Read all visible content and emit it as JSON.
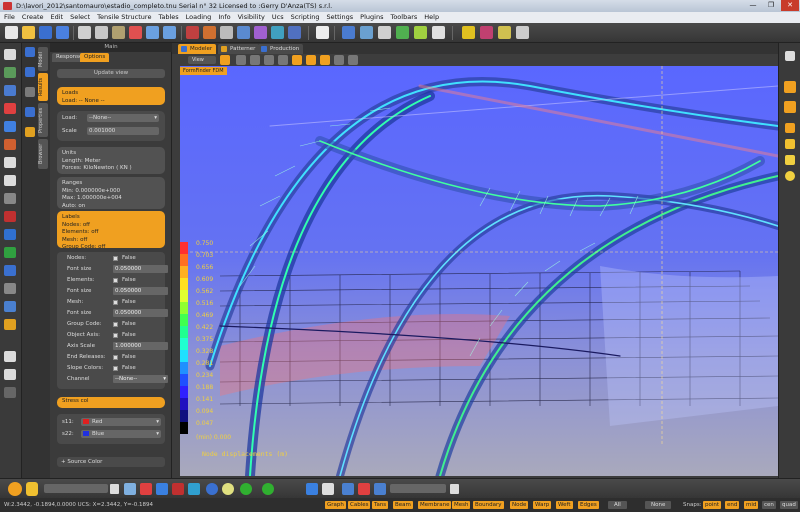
{
  "window": {
    "title": "D:\\lavori_2012\\santomauro\\estadio_completo.tnu  Serial n° 32  Licensed to :Gerry D'Anza(TS) s.r.l.",
    "controls": [
      "—",
      "❐",
      "✕"
    ]
  },
  "menu": [
    "File",
    "Create",
    "Edit",
    "Select",
    "Tensile Structure",
    "Tables",
    "Loading",
    "Info",
    "Visibility",
    "Ucs",
    "Scripting",
    "Settings",
    "Plugins",
    "Toolbars",
    "Help"
  ],
  "panel": {
    "header": "Main",
    "tabs": {
      "response": "Response",
      "options": "Options"
    },
    "update_view": "Update view",
    "vertical_tabs": [
      "Model",
      "Results",
      "Properties",
      "Browser"
    ],
    "loads_box": {
      "title": "Loads",
      "value": "Load: -- None --"
    },
    "load_field": {
      "label": "Load:",
      "value": "--None--"
    },
    "scale_field": {
      "label": "Scale",
      "value": "0.001000"
    },
    "units": {
      "title": "Units",
      "length": "Length: Meter",
      "forces": "Forces: KiloNewton ( KN )"
    },
    "ranges": {
      "title": "Ranges",
      "min": "Min: 0.000000e+000",
      "max": "Max: 1.000000e+004",
      "auto": "Auto: on"
    },
    "labels_box": {
      "title": "Labels",
      "nodes": "Nodes: off",
      "elements": "Elements: off",
      "mesh": "Mesh: off",
      "group_code": "Group Code: off"
    },
    "options": [
      {
        "label": "Nodes:",
        "type": "check",
        "value": "False"
      },
      {
        "label": "Font size",
        "type": "field",
        "value": "0.050000"
      },
      {
        "label": "Elements:",
        "type": "check",
        "value": "False"
      },
      {
        "label": "Font size",
        "type": "field",
        "value": "0.050000"
      },
      {
        "label": "Mesh:",
        "type": "check",
        "value": "False"
      },
      {
        "label": "Font size",
        "type": "field",
        "value": "0.050000"
      },
      {
        "label": "Group Code:",
        "type": "check",
        "value": "False"
      },
      {
        "label": "Object Axis:",
        "type": "check",
        "value": "False"
      },
      {
        "label": "Axis Scale",
        "type": "field",
        "value": "1.000000"
      },
      {
        "label": "End Releases:",
        "type": "check",
        "value": "False"
      },
      {
        "label": "Slope Colors:",
        "type": "check",
        "value": "False"
      },
      {
        "label": "Channel",
        "type": "select",
        "value": "--None--"
      }
    ],
    "stress_box": {
      "title": "Stress col",
      "s11_label": "s11:",
      "s11_value": "Red",
      "s22_label": "s22:",
      "s22_value": "Blue",
      "s11_color": "#e02020",
      "s22_color": "#2030e0"
    },
    "source_color": "+ Source Color"
  },
  "view_tabs": [
    "Modeler",
    "Patterner",
    "Production"
  ],
  "view_toolbar": {
    "view_label": "View"
  },
  "formfinder_badge": "FormFinder  FDM",
  "legend": {
    "values": [
      "0.750",
      "0.703",
      "0.656",
      "0.609",
      "0.562",
      "0.516",
      "0.469",
      "0.422",
      "0.375",
      "0.328",
      "0.281",
      "0.234",
      "0.188",
      "0.141",
      "0.094",
      "0.047"
    ],
    "min_label": "(min)  0.000",
    "caption": "Node displacements (m)",
    "colors": [
      "#ff3030",
      "#ff7020",
      "#ffb020",
      "#ffe020",
      "#e0ff30",
      "#90ff30",
      "#40ff50",
      "#20ff90",
      "#20ffd0",
      "#20e0ff",
      "#2090ff",
      "#2050ff",
      "#3020ff",
      "#2010c0",
      "#101080",
      "#000000"
    ]
  },
  "bottom": {
    "filters": [
      "Graph",
      "Cables",
      "Tans",
      "Beam",
      "Membrane",
      "Mesh",
      "Boundary",
      "Node",
      "Warp",
      "Weft",
      "Edges"
    ],
    "all_label": "All",
    "none_label": "None",
    "snaps_label": "Snaps:",
    "snaps": [
      "point",
      "end",
      "mid",
      "cen",
      "quad"
    ],
    "coords": "W:2.3442, -0.1894,0.0000   UCS: X=2.3442, Y=-0.1894"
  }
}
